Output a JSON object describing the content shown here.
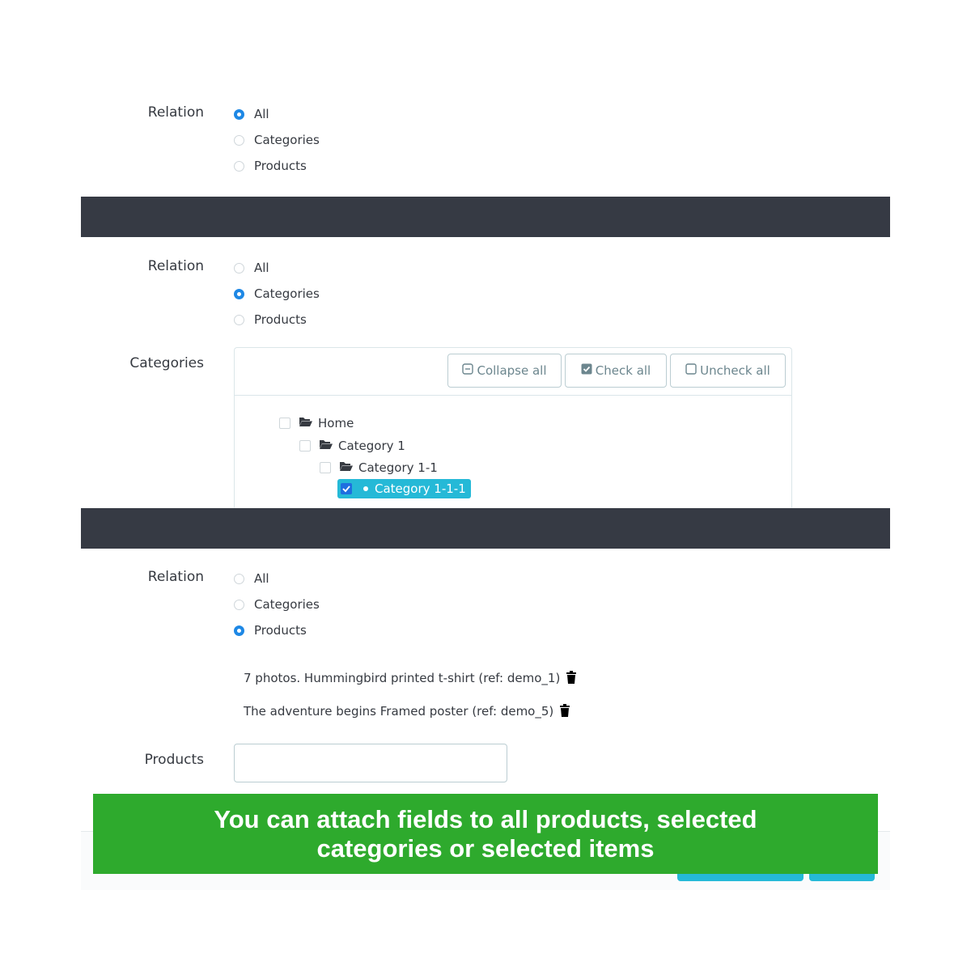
{
  "section1": {
    "relation_label": "Relation",
    "options": [
      {
        "label": "All",
        "checked": true
      },
      {
        "label": "Categories",
        "checked": false
      },
      {
        "label": "Products",
        "checked": false
      }
    ]
  },
  "section2": {
    "relation_label": "Relation",
    "options": [
      {
        "label": "All",
        "checked": false
      },
      {
        "label": "Categories",
        "checked": true
      },
      {
        "label": "Products",
        "checked": false
      }
    ],
    "categories_label": "Categories",
    "tree_buttons": {
      "collapse_all": "Collapse all",
      "check_all": "Check all",
      "uncheck_all": "Uncheck all"
    },
    "tree": [
      {
        "label": "Home",
        "level": 0,
        "checked": false,
        "type": "folder-open"
      },
      {
        "label": "Category 1",
        "level": 1,
        "checked": false,
        "type": "folder-open"
      },
      {
        "label": "Category 1-1",
        "level": 2,
        "checked": false,
        "type": "folder-open"
      },
      {
        "label": "Category 1-1-1",
        "level": 3,
        "checked": true,
        "type": "leaf"
      }
    ]
  },
  "section3": {
    "relation_label": "Relation",
    "options": [
      {
        "label": "All",
        "checked": false
      },
      {
        "label": "Categories",
        "checked": false
      },
      {
        "label": "Products",
        "checked": true
      }
    ],
    "selected_products": [
      {
        "label": "7 photos. Hummingbird printed t-shirt (ref: demo_1)"
      },
      {
        "label": "The adventure begins Framed poster (ref: demo_5)"
      }
    ],
    "products_label": "Products",
    "products_input": {
      "value": "",
      "placeholder": ""
    }
  },
  "banner": {
    "text": "You can attach fields to all products, selected categories or selected items",
    "color": "#2eaa2d"
  },
  "colors": {
    "accent": "#25b9d7",
    "radio_checked": "#1e88e5",
    "divider": "#363a44"
  }
}
